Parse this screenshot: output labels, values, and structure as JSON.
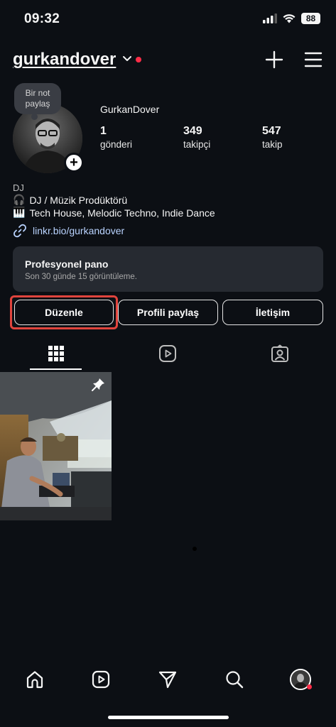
{
  "status_bar": {
    "time": "09:32",
    "battery": "88"
  },
  "header": {
    "username": "gurkandover"
  },
  "profile": {
    "note": "Bir not paylaş",
    "display_name": "GurkanDover",
    "stats": [
      {
        "value": "1",
        "label": "gönderi"
      },
      {
        "value": "349",
        "label": "takipçi"
      },
      {
        "value": "547",
        "label": "takip"
      }
    ]
  },
  "bio": {
    "category": "DJ",
    "lines": [
      {
        "emoji": "🎧",
        "text": "DJ / Müzik Prodüktörü"
      },
      {
        "emoji": "🎹",
        "text": "Tech House, Melodic Techno, Indie Dance"
      }
    ],
    "link": "linkr.bio/gurkandover"
  },
  "pro_dashboard": {
    "title": "Profesyonel pano",
    "subtitle": "Son 30 günde 15 görüntüleme."
  },
  "buttons": {
    "edit": "Düzenle",
    "share": "Profili paylaş",
    "contact": "İletişim"
  },
  "tabs": [
    "grid-icon",
    "reels-icon",
    "tagged-icon"
  ],
  "nav": [
    "home-icon",
    "reels-icon",
    "send-icon",
    "search-icon",
    "profile-avatar"
  ],
  "colors": {
    "accent_red": "#e0443d",
    "notification": "#ff2d48",
    "link": "#b9d3ff",
    "background": "#0c0f14"
  }
}
